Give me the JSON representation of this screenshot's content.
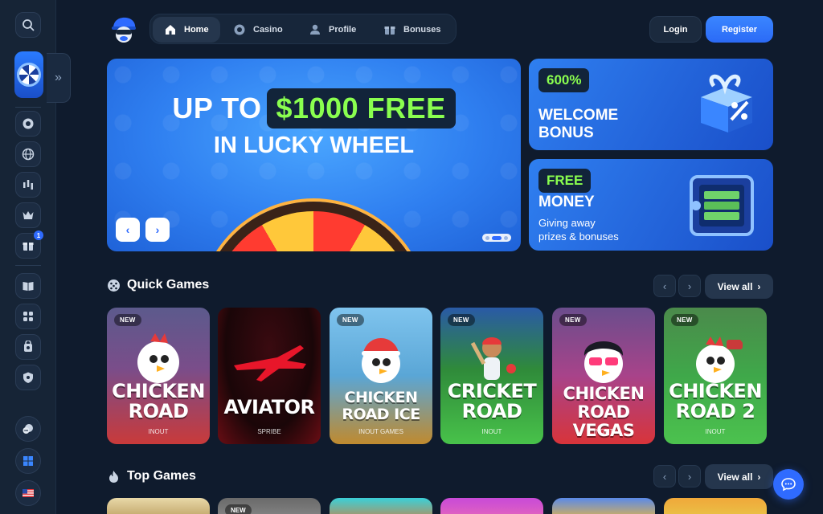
{
  "nav": {
    "items": [
      {
        "label": "Home",
        "icon": "home-icon",
        "active": true
      },
      {
        "label": "Casino",
        "icon": "casino-chip-icon",
        "active": false
      },
      {
        "label": "Profile",
        "icon": "profile-icon",
        "active": false
      },
      {
        "label": "Bonuses",
        "icon": "gift-icon",
        "active": false
      }
    ],
    "login_label": "Login",
    "register_label": "Register"
  },
  "sidebar": {
    "icons": [
      "search-icon",
      "casino-chip-icon",
      "globe-icon",
      "trading-icon",
      "crown-icon",
      "gift-icon",
      "book-icon",
      "puzzle-icon",
      "shield-lock-icon",
      "shield-icon",
      "support-icon",
      "windows-icon",
      "us-flag-icon"
    ],
    "gift_badge": "1"
  },
  "hero": {
    "line1_plain": "UP TO",
    "line1_highlight": "$1000 FREE",
    "line2": "IN LUCKY WHEEL",
    "prev": "‹",
    "next": "›"
  },
  "promos": {
    "welcome": {
      "tag": "600%",
      "line1": "WELCOME",
      "line2": "BONUS"
    },
    "money": {
      "tag": "FREE",
      "title": "MONEY",
      "line1": "Giving away",
      "line2": "prizes & bonuses"
    }
  },
  "quick_games": {
    "title": "Quick Games",
    "view_all": "View all",
    "games": [
      {
        "name_line1": "CHICKEN",
        "name_line2": "ROAD",
        "provider": "INOUT",
        "badge": "NEW"
      },
      {
        "name_line1": "AVIATOR",
        "name_line2": "",
        "provider": "SPRIBE",
        "badge": ""
      },
      {
        "name_line1": "CHICKEN",
        "name_line2": "ROAD ICE",
        "provider": "INOUT GAMES",
        "badge": "NEW"
      },
      {
        "name_line1": "CRICKET",
        "name_line2": "ROAD",
        "provider": "INOUT",
        "badge": "NEW"
      },
      {
        "name_line1": "CHICKEN",
        "name_line2": "ROAD VEGAS",
        "provider": "INOUT",
        "badge": "NEW"
      },
      {
        "name_line1": "CHICKEN",
        "name_line2": "ROAD 2",
        "provider": "INOUT",
        "badge": "NEW"
      }
    ]
  },
  "top_games": {
    "title": "Top Games",
    "view_all": "View all",
    "second_badge": "NEW"
  },
  "colors": {
    "bg": "#0f1b2d",
    "accent": "#2f6bff",
    "highlight": "#8aff4f"
  }
}
